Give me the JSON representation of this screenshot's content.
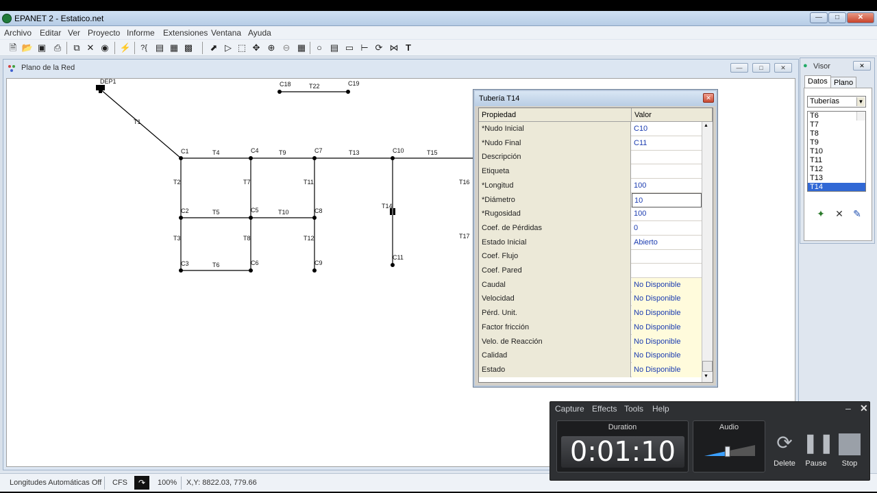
{
  "window": {
    "title": "EPANET 2 - Estatico.net"
  },
  "menu": [
    "Archivo",
    "Editar",
    "Ver",
    "Proyecto",
    "Informe",
    "Extensiones",
    "Ventana",
    "Ayuda"
  ],
  "toolbar": {
    "icons": [
      "new-file-icon",
      "open-folder-icon",
      "save-icon",
      "print-icon",
      "copy-icon",
      "delete-icon",
      "find-icon",
      "run-analysis-icon",
      "query-icon",
      "graph-icon",
      "table-icon",
      "options-icon",
      "select-object-icon",
      "select-vertex-icon",
      "select-region-icon",
      "pan-icon",
      "zoom-in-icon",
      "zoom-out-icon",
      "full-extent-icon",
      "add-junction-icon",
      "add-reservoir-icon",
      "add-tank-icon",
      "add-pipe-icon",
      "add-pump-icon",
      "add-valve-icon",
      "add-label-icon"
    ]
  },
  "map_window": {
    "title": "Plano de la Red",
    "nodes": [
      {
        "id": "DEP1"
      },
      {
        "id": "C1"
      },
      {
        "id": "C4"
      },
      {
        "id": "C7"
      },
      {
        "id": "C10"
      },
      {
        "id": "C2"
      },
      {
        "id": "C5"
      },
      {
        "id": "C8"
      },
      {
        "id": "C3"
      },
      {
        "id": "C6"
      },
      {
        "id": "C9"
      },
      {
        "id": "C11"
      },
      {
        "id": "C18"
      },
      {
        "id": "C19"
      }
    ],
    "pipes": [
      "T1",
      "T4",
      "T9",
      "T13",
      "T15",
      "T2",
      "T7",
      "T11",
      "T16",
      "T5",
      "T10",
      "T14",
      "T3",
      "T8",
      "T12",
      "T17",
      "T6",
      "T22"
    ]
  },
  "property_window": {
    "title": "Tubería T14",
    "col_property": "Propiedad",
    "col_value": "Valor",
    "rows": [
      {
        "name": "*Nudo Inicial",
        "value": "C10"
      },
      {
        "name": "*Nudo Final",
        "value": "C11"
      },
      {
        "name": "Descripción",
        "value": ""
      },
      {
        "name": "Etiqueta",
        "value": ""
      },
      {
        "name": "*Longitud",
        "value": "100"
      },
      {
        "name": "*Diámetro",
        "value": "10"
      },
      {
        "name": "*Rugosidad",
        "value": "100"
      },
      {
        "name": "Coef. de Pérdidas",
        "value": "0"
      },
      {
        "name": "Estado Inicial",
        "value": "Abierto"
      },
      {
        "name": "Coef. Flujo",
        "value": ""
      },
      {
        "name": "Coef. Pared",
        "value": ""
      },
      {
        "name": "Caudal",
        "value": "No Disponible"
      },
      {
        "name": "Velocidad",
        "value": "No Disponible"
      },
      {
        "name": "Pérd. Unit.",
        "value": "No Disponible"
      },
      {
        "name": "Factor fricción",
        "value": "No Disponible"
      },
      {
        "name": "Velo. de Reacción",
        "value": "No Disponible"
      },
      {
        "name": "Calidad",
        "value": "No Disponible"
      },
      {
        "name": "Estado",
        "value": "No Disponible"
      }
    ]
  },
  "visor": {
    "title": "Visor",
    "tabs": [
      "Datos",
      "Plano"
    ],
    "category": "Tuberías",
    "items": [
      "T6",
      "T7",
      "T8",
      "T9",
      "T10",
      "T11",
      "T12",
      "T13",
      "T14"
    ],
    "selected": "T14"
  },
  "statusbar": {
    "auto_length": "Longitudes Automáticas Off",
    "units": "CFS",
    "zoom": "100%",
    "xy": "X,Y: 8822.03, 779.66"
  },
  "recorder": {
    "menu": [
      "Capture",
      "Effects",
      "Tools",
      "Help"
    ],
    "duration_label": "Duration",
    "duration": "0:01:10",
    "audio_label": "Audio",
    "audio_level": 0.45,
    "controls": [
      "Delete",
      "Pause",
      "Stop"
    ]
  }
}
